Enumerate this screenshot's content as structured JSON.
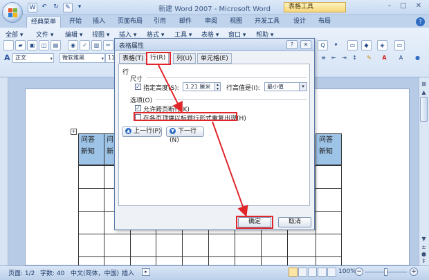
{
  "window": {
    "title": "新建 Word 2007 - Microsoft Word",
    "contextual_tab_group": "表格工具",
    "controls": {
      "minimize": "–",
      "maximize": "□",
      "close": "✕"
    }
  },
  "quick_access": [
    "W",
    "↶",
    "↻",
    "✎",
    "▾"
  ],
  "ribbon_tabs": [
    "经典菜单",
    "开始",
    "插入",
    "页面布局",
    "引用",
    "邮件",
    "审阅",
    "视图",
    "开发工具",
    "设计",
    "布局"
  ],
  "menu_bar": [
    "全部 ▾",
    "文件 ▾",
    "编辑 ▾",
    "视图 ▾",
    "插入 ▾",
    "格式 ▾",
    "工具 ▾",
    "表格 ▾",
    "窗口 ▾",
    "帮助 ▾"
  ],
  "toolbar": {
    "style_value": "正文",
    "font_value": "微软雅黑",
    "size_value": "11"
  },
  "dialog": {
    "title": "表格属性",
    "help_glyph": "?",
    "close_glyph": "✕",
    "tabs": [
      "表格(T)",
      "行(R)",
      "列(U)",
      "单元格(E)"
    ],
    "section_row": "行",
    "size_label": "尺寸",
    "specify_height_label": "指定高度(S):",
    "height_value": "1.21 厘米",
    "height_is_label": "行高值是(I):",
    "height_is_value": "最小值",
    "options_label": "选项(O)",
    "allow_break_label": "允许跨页断行(K)",
    "repeat_header_label": "在各页顶端以标题行形式重复出现(H)",
    "prev_row": "上一行(P)",
    "next_row": "下一行(N)",
    "ok": "确定",
    "cancel": "取消"
  },
  "table": {
    "header_text": [
      "问答",
      "新知"
    ],
    "right_header_text": [
      "问答",
      "新知"
    ]
  },
  "statusbar": {
    "page": "页面: 1/2",
    "words": "字数: 40",
    "language": "中文(简体，中国)",
    "mode": "插入",
    "zoom": "100%"
  },
  "colors": {
    "table_header": "#9dc3e6",
    "highlight": "#e0262b"
  }
}
